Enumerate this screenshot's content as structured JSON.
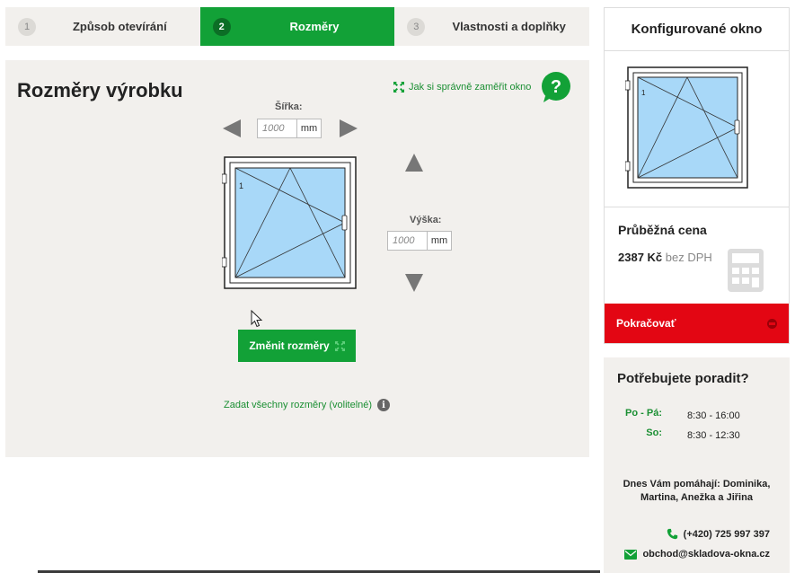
{
  "steps": [
    {
      "num": "1",
      "label": "Způsob otevírání",
      "active": false
    },
    {
      "num": "2",
      "label": "Rozměry",
      "active": true
    },
    {
      "num": "3",
      "label": "Vlastnosti a doplňky",
      "active": false
    }
  ],
  "main": {
    "title": "Rozměry výrobku",
    "help_link": "Jak si správně zaměřit okno",
    "help_icon": "question-icon",
    "width_label": "Šířka:",
    "width_value": "1000",
    "height_label": "Výška:",
    "height_value": "1000",
    "unit": "mm",
    "window_sash_number": "1",
    "change_button": "Změnit rozměry",
    "all_dims_link": "Zadat všechny rozměry (volitelné)",
    "info_icon_glyph": "i"
  },
  "config": {
    "title": "Konfigurované okno",
    "preview_sash_number": "1",
    "price_title": "Průběžná cena",
    "price_amount": "2387 Kč",
    "price_suffix": "bez DPH",
    "continue_button": "Pokračovať"
  },
  "advice": {
    "title": "Potřebujete poradit?",
    "hours": [
      {
        "day": "Po - Pá:",
        "time": "8:30 - 16:00"
      },
      {
        "day": "So:",
        "time": "8:30 - 12:30"
      }
    ],
    "today": "Dnes Vám pomáhají: Dominika, Martina, Anežka a Jiřina",
    "phone": "(+420) 725 997 397",
    "email": "obchod@skladova-okna.cz"
  },
  "colors": {
    "accent_green": "#12a137",
    "panel_bg": "#f2f0ed",
    "continue_red": "#e30613",
    "glass_blue": "#a8d8f8"
  }
}
